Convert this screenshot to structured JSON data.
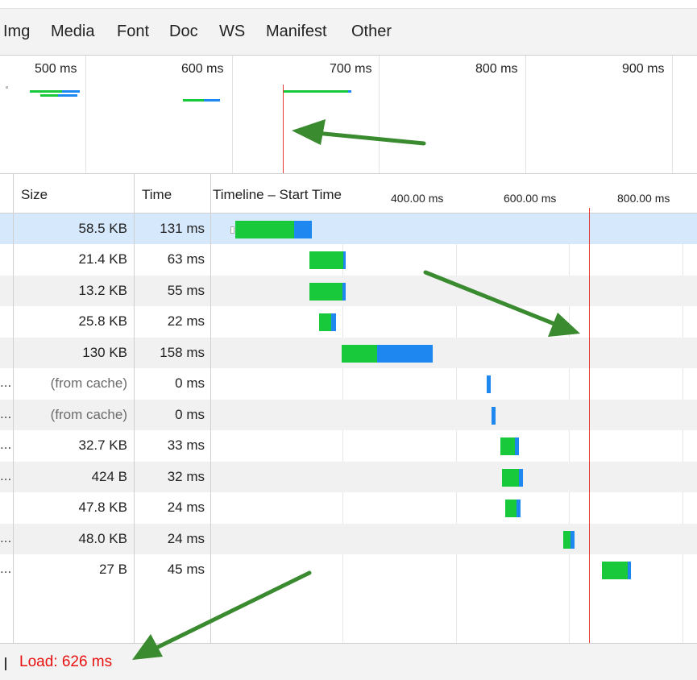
{
  "filters": [
    "Img",
    "Media",
    "Font",
    "Doc",
    "WS",
    "Manifest",
    "Other"
  ],
  "overview": {
    "ticks": [
      "500 ms",
      "600 ms",
      "700 ms",
      "800 ms",
      "900 ms"
    ]
  },
  "columns": {
    "size": "Size",
    "time": "Time",
    "timeline": "Timeline – Start Time",
    "scale": [
      "400.00 ms",
      "600.00 ms",
      "800.00 ms"
    ]
  },
  "rows": [
    {
      "ellipsis": "",
      "size": "58.5 KB",
      "time": "131 ms"
    },
    {
      "ellipsis": "",
      "size": "21.4 KB",
      "time": "63 ms"
    },
    {
      "ellipsis": "",
      "size": "13.2 KB",
      "time": "55 ms"
    },
    {
      "ellipsis": "",
      "size": "25.8 KB",
      "time": "22 ms"
    },
    {
      "ellipsis": "",
      "size": "130 KB",
      "time": "158 ms"
    },
    {
      "ellipsis": "...",
      "size": "(from cache)",
      "time": "0 ms"
    },
    {
      "ellipsis": "...",
      "size": "(from cache)",
      "time": "0 ms"
    },
    {
      "ellipsis": "...",
      "size": "32.7 KB",
      "time": "33 ms"
    },
    {
      "ellipsis": "...",
      "size": "424 B",
      "time": "32 ms"
    },
    {
      "ellipsis": "",
      "size": "47.8 KB",
      "time": "24 ms"
    },
    {
      "ellipsis": "...",
      "size": "48.0 KB",
      "time": "24 ms"
    },
    {
      "ellipsis": "...",
      "size": "27 B",
      "time": "45 ms"
    }
  ],
  "footer": {
    "load": "Load: 626 ms"
  },
  "colors": {
    "waiting": "#18c93c",
    "receiving": "#1e88f0",
    "load_line": "#e53935",
    "annotation_arrow": "#3a8a2f"
  }
}
